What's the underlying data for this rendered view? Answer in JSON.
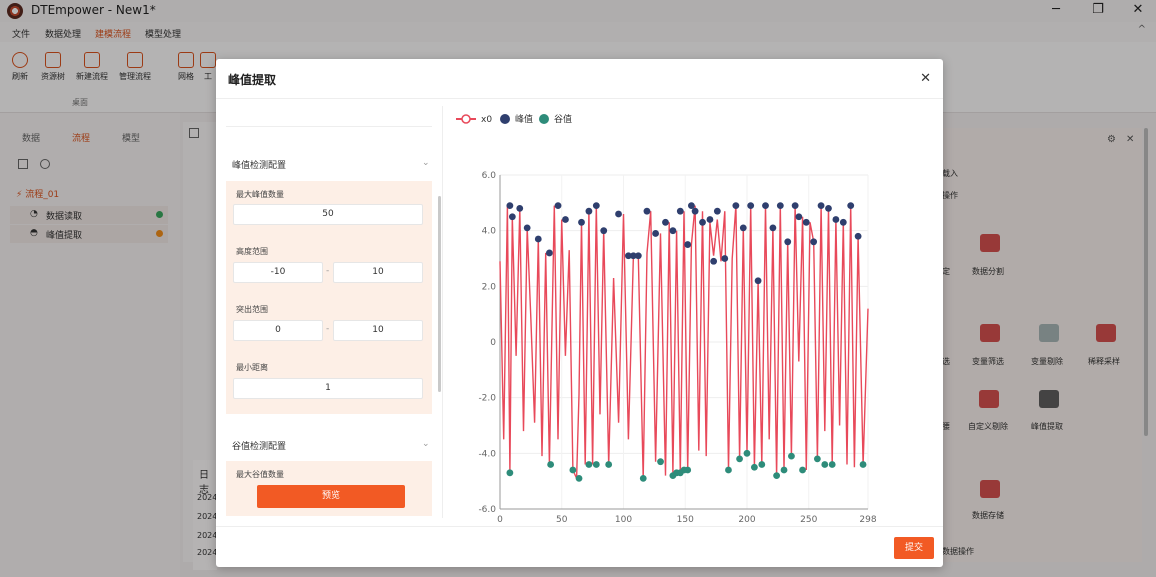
{
  "window": {
    "title": "DTEmpower - New1*",
    "minimize": "─",
    "restore": "❐",
    "close": "✕"
  },
  "menu": {
    "items": [
      "文件",
      "数据处理",
      "建模流程",
      "模型处理"
    ],
    "active_index": 2,
    "collapse": "^"
  },
  "ribbon": {
    "buttons": [
      "刷新",
      "资源树",
      "新建流程",
      "管理流程",
      "网格",
      "工"
    ],
    "group_label": "桌面"
  },
  "left_panel": {
    "tabs": [
      "数据",
      "流程",
      "模型"
    ],
    "active_tab": 1,
    "flow_name": "流程_01",
    "items": [
      {
        "label": "数据读取",
        "status_color": "#3aa55d"
      },
      {
        "label": "峰值提取",
        "status_color": "#f08c1a"
      }
    ]
  },
  "log_panel": {
    "title": "日志",
    "lines": [
      "2024",
      "2024",
      "2024",
      "2024"
    ]
  },
  "right_panel": {
    "heading_1": "载入",
    "heading_2": "操作",
    "items": [
      "数据分割",
      "变量筛选",
      "变量剔除",
      "稀释采样",
      "自定义剔除",
      "峰值提取",
      "数据存储"
    ],
    "partial_1": "定",
    "partial_2": "选",
    "partial_3": "腰",
    "footer": "数据操作"
  },
  "modal": {
    "title": "峰值提取",
    "close": "✕",
    "top_section_partial": "",
    "peak_section": {
      "title": "峰值检测配置",
      "max_count_label": "最大峰值数量",
      "max_count_value": "50",
      "height_label": "高度范围",
      "height_min": "-10",
      "height_max": "10",
      "prominence_label": "突出范围",
      "prominence_min": "0",
      "prominence_max": "10",
      "min_distance_label": "最小距离",
      "min_distance_value": "1",
      "range_separator": "-"
    },
    "valley_section": {
      "title": "谷值检测配置",
      "max_count_label": "最大谷值数量"
    },
    "preview_button": "预览",
    "submit_button": "提交"
  },
  "colors": {
    "accent": "#f25a24",
    "series_line": "#e8495a",
    "peak_marker": "#2f3f6e",
    "valley_marker": "#2e8c7a"
  },
  "chart_data": {
    "type": "line",
    "legend": [
      "x0",
      "峰值",
      "谷值"
    ],
    "legend_position": "top-left",
    "xlim": [
      0,
      298
    ],
    "ylim": [
      -6,
      6
    ],
    "x_ticks": [
      0,
      50,
      100,
      150,
      200,
      250,
      298
    ],
    "y_ticks": [
      6.0,
      4.0,
      2.0,
      0,
      -2.0,
      -4.0,
      -6.0
    ],
    "grid": true,
    "series": [
      {
        "name": "x0",
        "x": [
          0,
          3,
          6,
          8,
          10,
          13,
          16,
          19,
          22,
          25,
          28,
          31,
          34,
          37,
          40,
          44,
          47,
          50,
          53,
          56,
          59,
          62,
          64,
          66,
          69,
          72,
          75,
          78,
          81,
          84,
          88,
          92,
          96,
          100,
          104,
          108,
          112,
          116,
          119,
          122,
          126,
          130,
          134,
          137,
          140,
          143,
          146,
          149,
          152,
          155,
          158,
          161,
          164,
          167,
          170,
          173,
          176,
          179,
          182,
          185,
          188,
          191,
          194,
          197,
          200,
          203,
          206,
          209,
          212,
          215,
          218,
          221,
          224,
          227,
          230,
          233,
          236,
          239,
          242,
          245,
          248,
          251,
          254,
          257,
          260,
          263,
          266,
          269,
          272,
          275,
          278,
          281,
          284,
          287,
          290,
          294,
          298
        ],
        "y": [
          2.9,
          -3.5,
          4.9,
          -4.7,
          4.5,
          -0.5,
          4.8,
          -3.2,
          4.1,
          0.8,
          -2.9,
          3.7,
          -4.1,
          3.2,
          -4.4,
          4.9,
          -3.5,
          4.4,
          -0.5,
          3.3,
          -4.6,
          -4.9,
          -1.9,
          4.3,
          -4.4,
          4.7,
          -4.4,
          4.9,
          -2.6,
          4.0,
          -4.4,
          2.3,
          -2.9,
          4.6,
          -3.5,
          3.1,
          3.1,
          -4.9,
          3.2,
          4.7,
          -4.3,
          3.9,
          -4.8,
          4.3,
          -4.7,
          4.0,
          -4.7,
          4.7,
          -4.6,
          3.5,
          4.9,
          -3.9,
          4.7,
          -4.1,
          4.3,
          3.1,
          4.4,
          2.9,
          4.7,
          -4.6,
          3.0,
          4.9,
          -4.2,
          4.1,
          -4.0,
          4.9,
          -4.5,
          2.2,
          -4.4,
          4.9,
          -3.5,
          4.1,
          -4.8,
          4.9,
          -4.6,
          3.6,
          -4.1,
          4.9,
          -0.7,
          4.5,
          -4.6,
          4.3,
          3.6,
          -4.2,
          4.9,
          -3.2,
          4.8,
          -4.4,
          4.4,
          -3.0,
          4.3,
          -4.4,
          4.9,
          -4.5,
          3.8,
          -4.4,
          1.2
        ]
      },
      {
        "name": "峰值",
        "x": [
          8,
          10,
          16,
          22,
          31,
          40,
          47,
          53,
          66,
          72,
          78,
          84,
          96,
          104,
          108,
          112,
          119,
          126,
          134,
          140,
          146,
          152,
          155,
          158,
          164,
          170,
          173,
          176,
          182,
          191,
          197,
          203,
          209,
          215,
          221,
          227,
          233,
          239,
          242,
          248,
          254,
          260,
          266,
          272,
          278,
          284,
          290
        ],
        "y": [
          4.9,
          4.5,
          4.8,
          4.1,
          3.7,
          3.2,
          4.9,
          4.4,
          4.3,
          4.7,
          4.9,
          4.0,
          4.6,
          3.1,
          3.1,
          3.1,
          4.7,
          3.9,
          4.3,
          4.0,
          4.7,
          3.5,
          4.9,
          4.7,
          4.3,
          4.4,
          2.9,
          4.7,
          3.0,
          4.9,
          4.1,
          4.9,
          2.2,
          4.9,
          4.1,
          4.9,
          3.6,
          4.9,
          4.5,
          4.3,
          3.6,
          4.9,
          4.8,
          4.4,
          4.3,
          4.9,
          3.8
        ]
      },
      {
        "name": "谷值",
        "x": [
          8,
          41,
          59,
          64,
          72,
          78,
          88,
          116,
          130,
          140,
          143,
          146,
          149,
          152,
          185,
          194,
          200,
          206,
          212,
          224,
          230,
          236,
          245,
          257,
          263,
          269,
          294
        ],
        "y": [
          -4.7,
          -4.4,
          -4.6,
          -4.9,
          -4.4,
          -4.4,
          -4.4,
          -4.9,
          -4.3,
          -4.8,
          -4.7,
          -4.7,
          -4.6,
          -4.6,
          -4.6,
          -4.2,
          -4.0,
          -4.5,
          -4.4,
          -4.8,
          -4.6,
          -4.1,
          -4.6,
          -4.2,
          -4.4,
          -4.4,
          -4.4
        ]
      }
    ]
  }
}
